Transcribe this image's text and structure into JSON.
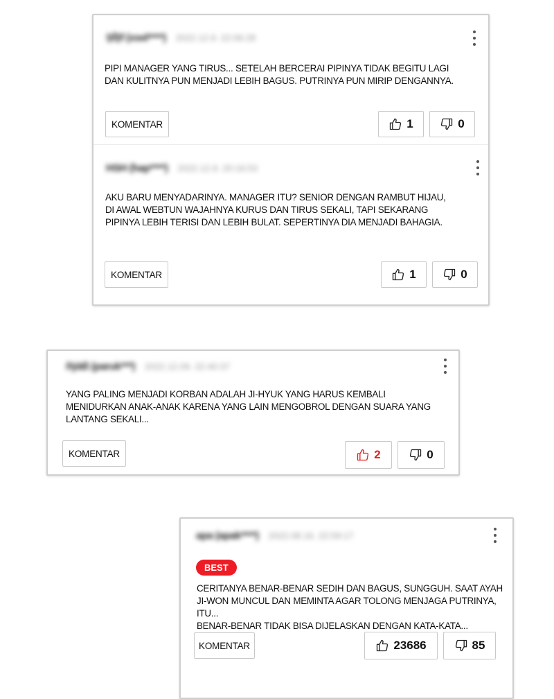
{
  "card1": {
    "c1": {
      "author": "Ṣḟẓ̈f (xsel****)",
      "date": "2022.12.9. 22:06:28",
      "text_lines": [
        "PIPI MANAGER YANG TIRUS... SETELAH BERCERAI PIPINYA TIDAK BEGITU LAGI",
        "DAN KULITNYA PUN MENJADI LEBIH BAGUS. PUTRINYA PUN MIRIP DENGANNYA."
      ],
      "comment_label": "KOMENTAR",
      "likes": "1",
      "dislikes": "0"
    },
    "c2": {
      "author": "HSH (hap****)",
      "date": "2022.12.9. 20:16:53",
      "text_lines": [
        "AKU BARU MENYADARINYA. MANAGER ITU? SENIOR DENGAN RAMBUT HIJAU,",
        "DI AWAL WEBTUN WAJAHNYA KURUS DAN TIRUS SEKALI, TAPI SEKARANG",
        "PIPINYA LEBIH TERISI DAN LEBIH BULAT. SEPERTINYA DIA MENJADI BAHAGIA."
      ],
      "comment_label": "KOMENTAR",
      "likes": "1",
      "dislikes": "0"
    }
  },
  "card2": {
    "author": "ñÿäß (paruk***)",
    "date": "2022.12.09. 22:40:37",
    "text_lines": [
      "YANG PALING MENJADI KORBAN ADALAH JI-HYUK YANG HARUS KEMBALI",
      "MENIDURKAN ANAK-ANAK KARENA YANG LAIN MENGOBROL DENGAN SUARA YANG",
      "LANTANG SEKALI..."
    ],
    "comment_label": "KOMENTAR",
    "likes": "2",
    "dislikes": "0"
  },
  "card3": {
    "author": "apa (apak****)",
    "date": "2022.08.16. 22:59:17",
    "badge": "BEST",
    "text_lines": [
      "CERITANYA BENAR-BENAR SEDIH DAN BAGUS, SUNGGUH. SAAT AYAH",
      "JI-WON MUNCUL DAN MEMINTA AGAR TOLONG MENJAGA PUTRINYA, ITU...",
      "BENAR-BENAR TIDAK BISA DIJELASKAN DENGAN KATA-KATA..."
    ],
    "comment_label": "KOMENTAR",
    "likes": "23686",
    "dislikes": "85"
  },
  "colors": {
    "accent_red": "#ee1c25",
    "border": "#cfcfcf"
  },
  "icons": {
    "like": "thumbs-up-icon",
    "dislike": "thumbs-down-icon",
    "more": "more-vertical-icon"
  }
}
